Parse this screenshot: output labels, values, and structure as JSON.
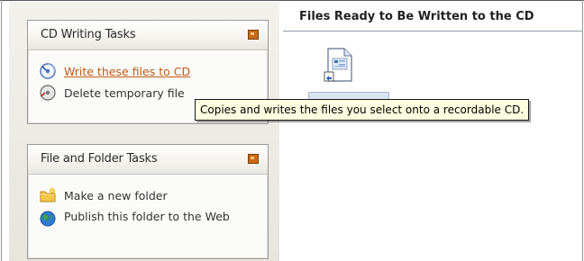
{
  "right_pane": {
    "title": "Files Ready to Be Written to the CD",
    "file_item": {
      "icon": "document-icon",
      "state": "selected"
    }
  },
  "cd_writing_tasks": {
    "title": "CD Writing Tasks",
    "collapse_icon": "collapse-icon",
    "items": [
      {
        "label": "Write these files to CD",
        "icon": "write-cd-icon",
        "state": "hover"
      },
      {
        "label": "Delete temporary files",
        "icon": "delete-files-icon",
        "visible_label": "Delete temporary file"
      }
    ]
  },
  "file_folder_tasks": {
    "title": "File and Folder Tasks",
    "collapse_icon": "collapse-icon",
    "items": [
      {
        "label": "Make a new folder",
        "icon": "new-folder-icon"
      },
      {
        "label": "Publish this folder to the Web",
        "icon": "publish-web-icon"
      }
    ]
  },
  "tooltip": {
    "text": "Copies and writes the files you select onto a recordable CD."
  },
  "colors": {
    "link_hover": "#c05a12",
    "collapse_button": "#c96a15",
    "tooltip_bg": "#ffffe1"
  }
}
